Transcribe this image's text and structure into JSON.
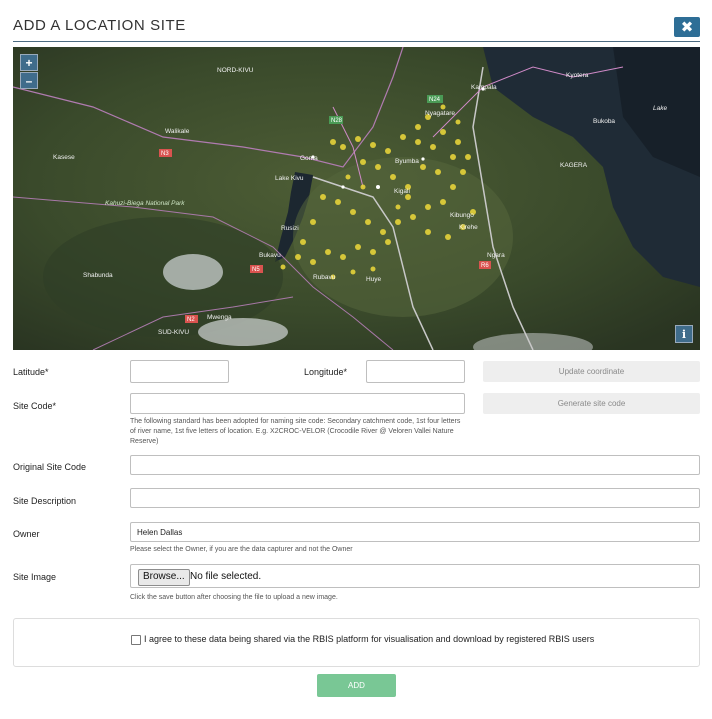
{
  "dialog": {
    "title": "ADD A LOCATION SITE",
    "close_icon": "close-x-icon"
  },
  "map": {
    "zoom_in": "+",
    "zoom_out": "–",
    "info": "i",
    "place_labels": [
      "NORD-KIVU",
      "Kampala",
      "Kyotera",
      "Walikale",
      "Kasese",
      "Lake Kivu",
      "Goma",
      "Bukavu",
      "Rubavu",
      "Byumba",
      "Kigali",
      "Nyagatare",
      "Kibungo",
      "Kirehe",
      "Huye",
      "Rusizi",
      "Shabunda",
      "Mwenga",
      "SUD-KIVU",
      "KAGERA",
      "Ngara",
      "Bukoba",
      "Lake",
      "Kahuzi-Biega National Park",
      "N3",
      "N2",
      "N5"
    ]
  },
  "form": {
    "latitude_label": "Latitude*",
    "latitude_value": "",
    "longitude_label": "Longitude*",
    "longitude_value": "",
    "update_button": "Update coordinate",
    "site_code_label": "Site Code*",
    "site_code_value": "",
    "generate_button": "Generate site code",
    "site_code_help": "The following standard has been adopted for naming site code: Secondary catchment code, 1st four letters of river name, 1st five letters of location. E.g. X2CROC-VELOR (Crocodile River @ Veloren Vallei Nature Reserve)",
    "original_site_code_label": "Original Site Code",
    "original_site_code_value": "",
    "site_description_label": "Site Description",
    "site_description_value": "",
    "owner_label": "Owner",
    "owner_value": "Helen Dallas",
    "owner_help": "Please select the Owner, if you are the data capturer and not the Owner",
    "site_image_label": "Site Image",
    "browse_button": "Browse...",
    "no_file_text": "No file selected.",
    "image_help": "Click the save button after choosing the file to upload a new image.",
    "agree_text": "I agree to these data being shared via the RBIS platform for visualisation and download by registered RBIS users",
    "agree_checked": false,
    "add_button": "ADD"
  }
}
